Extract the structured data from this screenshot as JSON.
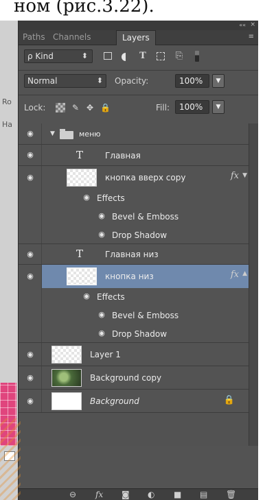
{
  "page_text": "ном (рис.3.22).",
  "canvas_strip": {
    "ro": "Ro",
    "ha": "Ha"
  },
  "panel": {
    "collapse": "««",
    "close": "×",
    "tabs": [
      {
        "label": "Paths",
        "active": false
      },
      {
        "label": "Channels",
        "active": false
      },
      {
        "label": "Layers",
        "active": true
      }
    ],
    "menu_icon": "≡",
    "filter": {
      "kind_label": "ρ Kind",
      "icons": [
        "image-filter-icon",
        "adjustment-filter-icon",
        "type-filter-icon",
        "shape-filter-icon",
        "smart-object-filter-icon",
        "filter-toggle-icon"
      ]
    },
    "blend": {
      "mode": "Normal",
      "opacity_label": "Opacity:",
      "opacity": "100%"
    },
    "lock": {
      "label": "Lock:",
      "fill_label": "Fill:",
      "fill": "100%"
    }
  },
  "layers": [
    {
      "name": "меню",
      "type": "group"
    },
    {
      "name": "Главная",
      "type": "text"
    },
    {
      "name": "кнопка вверх copy",
      "type": "image",
      "fx": "fx"
    },
    {
      "name": "Effects",
      "type": "effects"
    },
    {
      "name": "Bevel & Emboss",
      "type": "effect"
    },
    {
      "name": "Drop Shadow",
      "type": "effect"
    },
    {
      "name": "Главная низ",
      "type": "text"
    },
    {
      "name": "кнопка низ",
      "type": "image",
      "fx": "fx",
      "selected": true
    },
    {
      "name": "Effects",
      "type": "effects"
    },
    {
      "name": "Bevel & Emboss",
      "type": "effect"
    },
    {
      "name": "Drop Shadow",
      "type": "effect"
    },
    {
      "name": "Layer 1",
      "type": "image"
    },
    {
      "name": "Background copy",
      "type": "photo"
    },
    {
      "name": "Background",
      "type": "background",
      "locked": true
    }
  ],
  "bottom_icons": [
    "link-layers-icon",
    "add-layer-style-icon",
    "add-mask-icon",
    "new-adjustment-layer-icon",
    "new-group-icon",
    "new-layer-icon",
    "delete-layer-icon"
  ],
  "colors": {
    "panel": "#535353",
    "selected_row": "#6f89ad",
    "tab_bar": "#3f3f3f"
  }
}
